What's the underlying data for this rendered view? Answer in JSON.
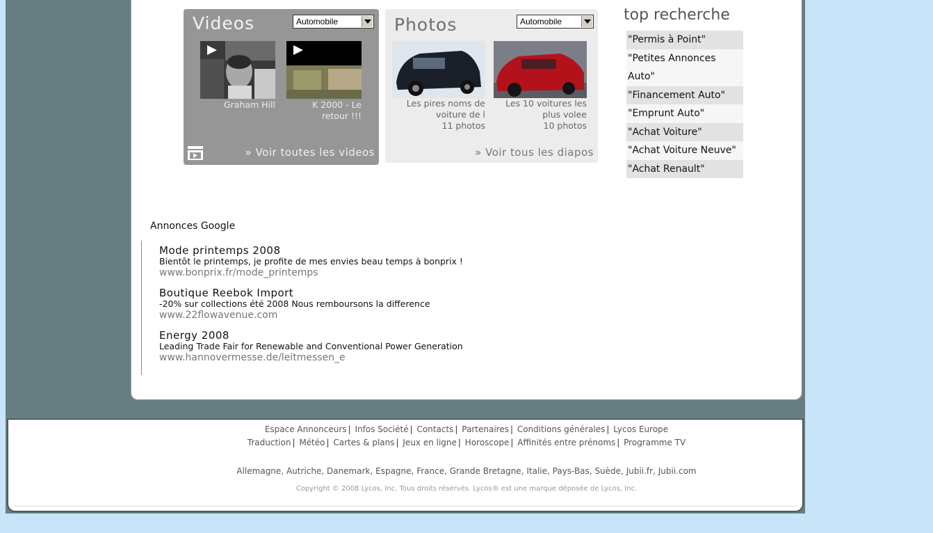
{
  "videos": {
    "title": "Videos",
    "category_select": "Automobile",
    "items": [
      {
        "caption": "Graham Hill"
      },
      {
        "caption": "K 2000 - Le retour !!!"
      }
    ],
    "see_all": "» Voir toutes les videos"
  },
  "photos": {
    "title": "Photos",
    "category_select": "Automobile",
    "items": [
      {
        "caption": "Les pires noms de voiture de l",
        "count": "11 photos"
      },
      {
        "caption": "Les 10 voitures les plus volee",
        "count": "10 photos"
      }
    ],
    "see_all": "» Voir tous les diapos"
  },
  "top_recherche": {
    "title": "top recherche",
    "items": [
      "\"Permis à Point\"",
      "\"Petites Annonces Auto\"",
      "\"Financement Auto\"",
      "\"Emprunt Auto\"",
      "\"Achat Voiture\"",
      "\"Achat Voiture Neuve\"",
      "\"Achat Renault\""
    ]
  },
  "ads": {
    "title": "Annonces Google",
    "items": [
      {
        "title": "Mode printemps 2008",
        "desc": "Bientôt le printemps, je profite de mes envies beau temps à bonprix !",
        "url": "www.bonprix.fr/mode_printemps"
      },
      {
        "title": "Boutique Reebok Import",
        "desc": "-20% sur collections été 2008 Nous remboursons la difference",
        "url": "www.22flowavenue.com"
      },
      {
        "title": "Energy 2008",
        "desc": "Leading Trade Fair for Renewable and Conventional Power Generation",
        "url": "www.hannovermesse.de/leitmessen_e"
      }
    ]
  },
  "footer": {
    "links_row1": [
      "Espace Annonceurs",
      "Infos Société",
      "Contacts",
      "Partenaires",
      "Conditions générales",
      "Lycos Europe"
    ],
    "links_row2": [
      "Traduction",
      "Météo",
      "Cartes & plans",
      "Jeux en ligne",
      "Horoscope",
      "Affinités entre prénoms",
      "Programme TV"
    ],
    "countries": [
      "Allemagne",
      "Autriche",
      "Danemark",
      "Espagne",
      "France",
      "Grande Bretagne",
      "Italie",
      "Pays-Bas",
      "Suède",
      "Jubii.fr",
      "Jubii.com"
    ],
    "copyright": "Copyright © 2008 Lycos, Inc. Tous droits réservés. Lycos® est une marque déposée de Lycos, Inc."
  }
}
